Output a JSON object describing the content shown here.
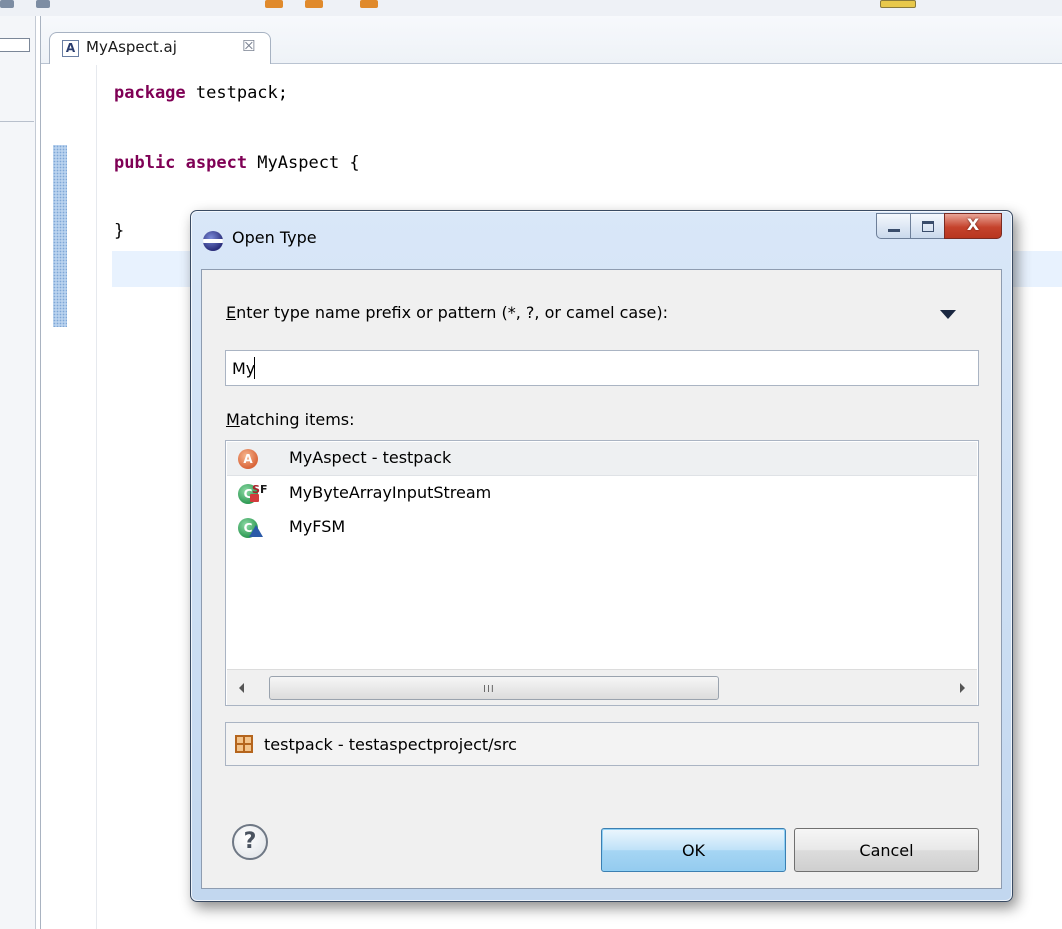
{
  "editor": {
    "tab_label": "MyAspect.aj",
    "tab_close": "☒",
    "code_lines": [
      {
        "keyword": "package",
        "rest": " testpack;"
      },
      {
        "keyword": "public aspect",
        "rest": " MyAspect {"
      },
      {
        "keyword": "",
        "rest": "}"
      }
    ]
  },
  "dialog": {
    "title": "Open Type",
    "minimize_label": "",
    "maximize_label": "",
    "close_label": "X",
    "prompt_first_letter": "E",
    "prompt_rest": "nter type name prefix or pattern (*, ?, or camel case):",
    "search_value": "My",
    "matching_first_letter": "M",
    "matching_rest": "atching items:",
    "results": [
      {
        "label": "MyAspect - testpack",
        "icon": "aspect-icon",
        "selected": true
      },
      {
        "label": "MyByteArrayInputStream",
        "icon": "static-final-class-icon",
        "selected": false
      },
      {
        "label": "MyFSM",
        "icon": "class-icon",
        "selected": false
      }
    ],
    "scroll_grip": "III",
    "details": "testpack - testaspectproject/src",
    "help_glyph": "?",
    "ok_label": "OK",
    "cancel_label": "Cancel"
  },
  "icons": {
    "aspect_glyph": "A",
    "class_glyph": "C",
    "badge_s": "S",
    "badge_f": "F"
  },
  "colors": {
    "keyword": "#7f0055",
    "selection": "#eef0f2",
    "close_button": "#c5432d",
    "ok_button": "#a6d6f4"
  }
}
